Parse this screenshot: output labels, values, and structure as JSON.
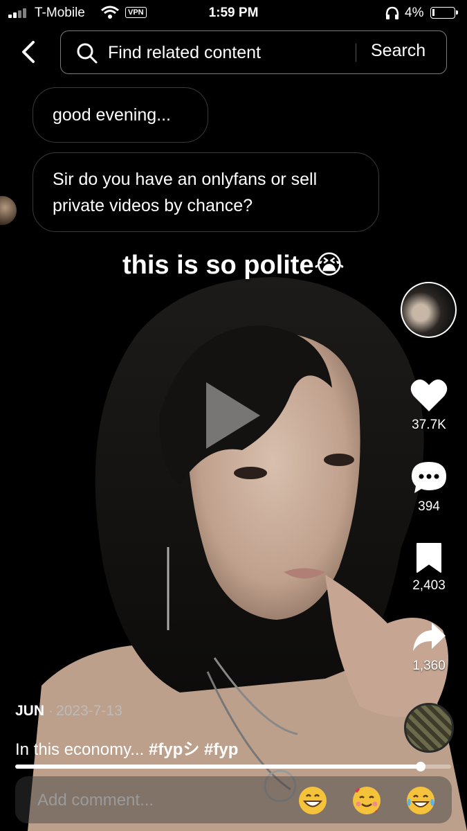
{
  "status_bar": {
    "carrier": "T-Mobile",
    "vpn": "VPN",
    "time": "1:59 PM",
    "battery": "4%"
  },
  "search": {
    "placeholder": "Find related content",
    "button": "Search"
  },
  "chat": {
    "message_1": "good evening...",
    "message_2": "Sir do you have an onlyfans or sell private videos by chance?"
  },
  "video": {
    "overlay_caption": "this is so polite😭"
  },
  "actions": {
    "likes": "37.7K",
    "comments": "394",
    "saves": "2,403",
    "shares": "1,360"
  },
  "post": {
    "author": "JUN",
    "date": "2023-7-13",
    "description": "In this economy...",
    "hashtags": [
      "#fypシ",
      "#fyp"
    ],
    "progress": 0.93
  },
  "comment": {
    "placeholder": "Add comment..."
  },
  "colors": {
    "background": "#000000",
    "text": "#ffffff"
  }
}
